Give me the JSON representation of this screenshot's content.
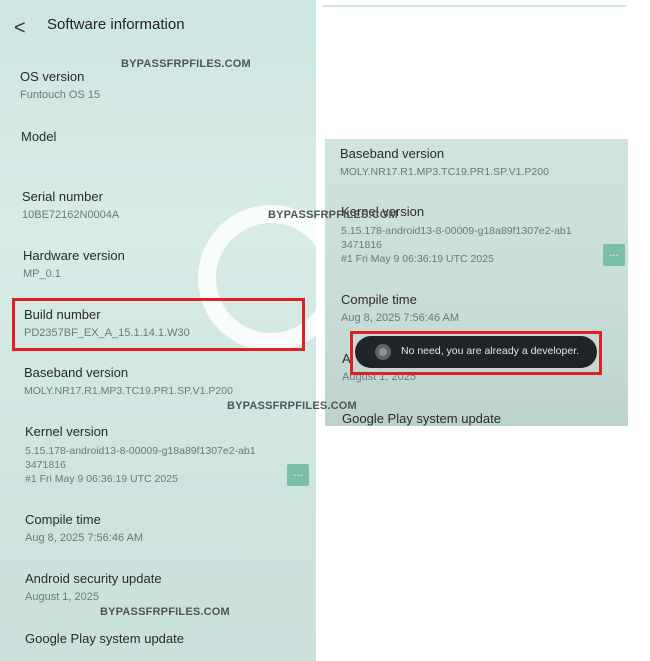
{
  "left_screen": {
    "title": "Software information",
    "back_glyph": "<",
    "items": [
      {
        "label": "OS version",
        "value": "Funtouch OS 15"
      },
      {
        "label": "Model",
        "value": ""
      },
      {
        "label": "Serial number",
        "value": "10BE72162N0004A"
      },
      {
        "label": "Hardware version",
        "value": "MP_0.1"
      },
      {
        "label": "Build number",
        "value": "PD2357BF_EX_A_15.1.14.1.W30"
      },
      {
        "label": "Baseband version",
        "value": "MOLY.NR17.R1.MP3.TC19.PR1.SP.V1.P200"
      },
      {
        "label": "Kernel version",
        "value_lines": [
          "5.15.178-android13-8-00009-g18a89f1307e2-ab1",
          "3471816",
          "#1 Fri May 9 06:36:19 UTC 2025"
        ]
      },
      {
        "label": "Compile time",
        "value": "Aug 8, 2025 7:56:46 AM"
      },
      {
        "label": "Android security update",
        "value": "August 1, 2025"
      },
      {
        "label": "Google Play system update",
        "value": ""
      }
    ],
    "more_button": "..."
  },
  "right_screen": {
    "items": [
      {
        "label": "Baseband version",
        "value": "MOLY.NR17.R1.MP3.TC19.PR1.SP.V1.P200"
      },
      {
        "label": "Kernel version",
        "value_lines": [
          "5.15.178-android13-8-00009-g18a89f1307e2-ab1",
          "3471816",
          "#1 Fri May 9 06:36:19 UTC 2025"
        ]
      },
      {
        "label": "Compile time",
        "value": "Aug 8, 2025 7:56:46 AM"
      },
      {
        "label": "A",
        "value": "August 1, 2025"
      },
      {
        "label": "Google Play system update",
        "value": ""
      }
    ],
    "more_button": "...",
    "toast": "No need, you are already a developer."
  },
  "watermarks": [
    "BYPASSFRPFILES.COM",
    "BYPASSFRPFILES.COM",
    "BYPASSFRPFILES.COM",
    "BYPASSFRPFILES.COM"
  ],
  "colors": {
    "highlight": "#e02020",
    "accent": "#7bbfa8"
  }
}
